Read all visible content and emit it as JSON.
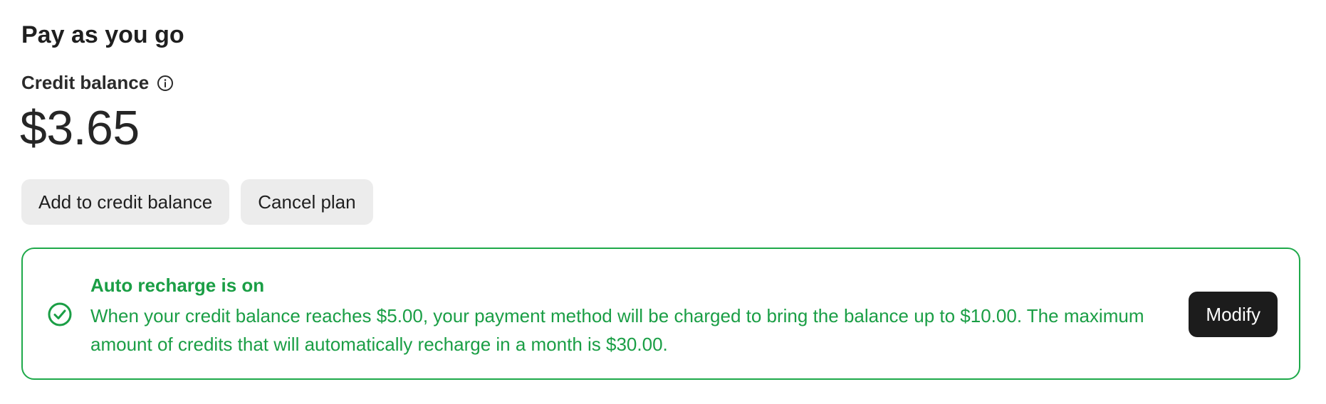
{
  "section": {
    "title": "Pay as you go"
  },
  "credit": {
    "label": "Credit balance",
    "info_icon": "info-circle-icon",
    "amount": "$3.65"
  },
  "actions": {
    "add_label": "Add to credit balance",
    "cancel_label": "Cancel plan"
  },
  "auto_recharge": {
    "icon": "check-circle-icon",
    "title": "Auto recharge is on",
    "description": "When your credit balance reaches $5.00, your payment method will be charged to bring the balance up to $10.00. The maximum amount of credits that will automatically recharge in a month is $30.00.",
    "modify_label": "Modify",
    "accent_color": "#1ea94a"
  }
}
